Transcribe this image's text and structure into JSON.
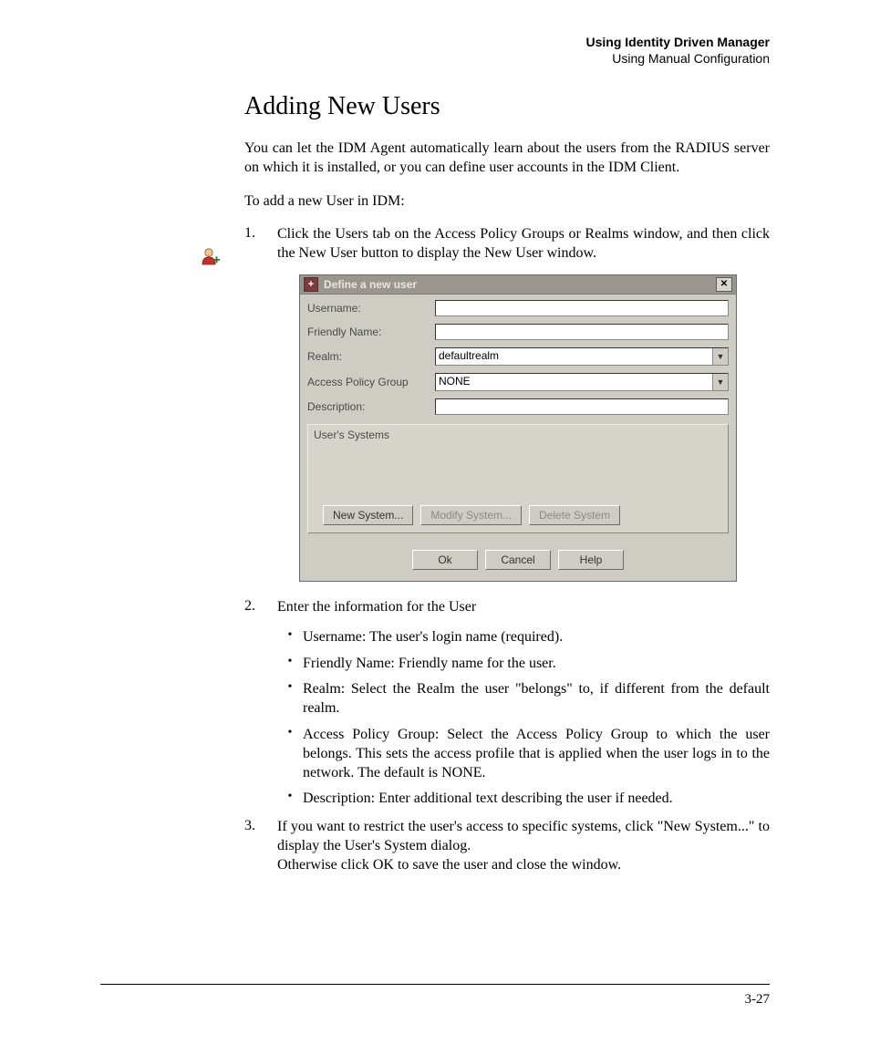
{
  "runningHead": {
    "line1": "Using Identity Driven Manager",
    "line2": "Using Manual Configuration"
  },
  "title": "Adding New Users",
  "intro": "You can let the IDM Agent automatically learn about the users from the RADIUS server on which it is installed, or you can define user accounts in the IDM Client.",
  "lead": "To add a new User in IDM:",
  "steps": {
    "s1": {
      "num": "1.",
      "text": "Click the Users tab on the Access Policy Groups or Realms window, and then click the New User button to display the New User window."
    },
    "s2": {
      "num": "2.",
      "text": "Enter the information for the User"
    },
    "s3": {
      "num": "3.",
      "text1": "If you want to restrict the user's access to specific systems, click \"New System...\" to display the User's System dialog.",
      "text2": "Otherwise click OK to save the user and close the window."
    }
  },
  "bullets": {
    "b1": "Username: The user's login name (required).",
    "b2": "Friendly Name: Friendly name for the user.",
    "b3": "Realm: Select the Realm the user \"belongs\" to, if different from the default realm.",
    "b4": "Access Policy Group: Select the Access Policy Group to which the user belongs. This sets the access profile that is applied when the user logs in to the network. The default is NONE.",
    "b5": "Description: Enter additional text describing the user if needed."
  },
  "dialog": {
    "title": "Define a new user",
    "fields": {
      "username": "Username:",
      "friendly": "Friendly Name:",
      "realm": "Realm:",
      "apg": "Access Policy Group",
      "desc": "Description:"
    },
    "values": {
      "realm": "defaultrealm",
      "apg": "NONE"
    },
    "systemsLabel": "User's Systems",
    "buttons": {
      "newSystem": "New System...",
      "modifySystem": "Modify System...",
      "deleteSystem": "Delete System",
      "ok": "Ok",
      "cancel": "Cancel",
      "help": "Help"
    }
  },
  "pageNumber": "3-27"
}
